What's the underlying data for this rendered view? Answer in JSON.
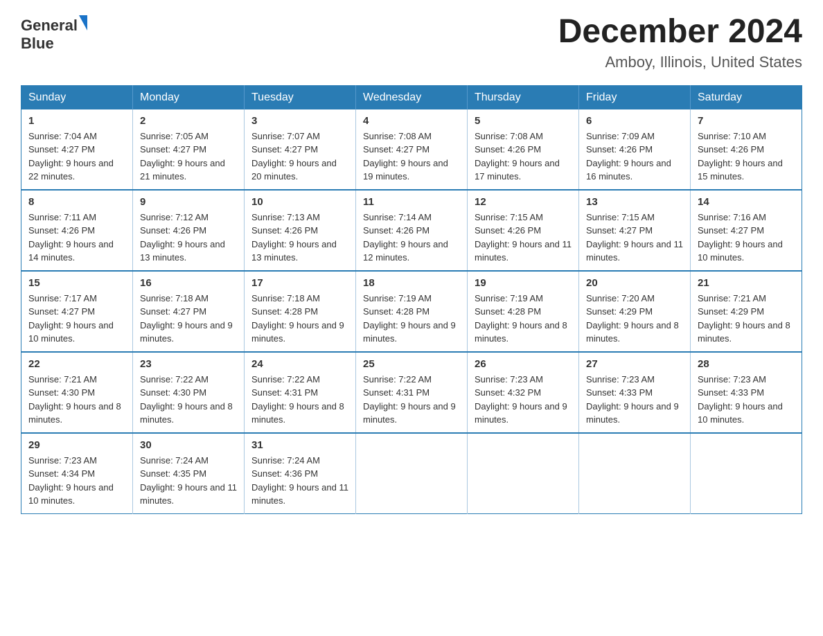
{
  "header": {
    "logo_text_general": "General",
    "logo_text_blue": "Blue",
    "month_year": "December 2024",
    "location": "Amboy, Illinois, United States"
  },
  "weekdays": [
    "Sunday",
    "Monday",
    "Tuesday",
    "Wednesday",
    "Thursday",
    "Friday",
    "Saturday"
  ],
  "weeks": [
    [
      {
        "day": "1",
        "sunrise": "7:04 AM",
        "sunset": "4:27 PM",
        "daylight": "9 hours and 22 minutes."
      },
      {
        "day": "2",
        "sunrise": "7:05 AM",
        "sunset": "4:27 PM",
        "daylight": "9 hours and 21 minutes."
      },
      {
        "day": "3",
        "sunrise": "7:07 AM",
        "sunset": "4:27 PM",
        "daylight": "9 hours and 20 minutes."
      },
      {
        "day": "4",
        "sunrise": "7:08 AM",
        "sunset": "4:27 PM",
        "daylight": "9 hours and 19 minutes."
      },
      {
        "day": "5",
        "sunrise": "7:08 AM",
        "sunset": "4:26 PM",
        "daylight": "9 hours and 17 minutes."
      },
      {
        "day": "6",
        "sunrise": "7:09 AM",
        "sunset": "4:26 PM",
        "daylight": "9 hours and 16 minutes."
      },
      {
        "day": "7",
        "sunrise": "7:10 AM",
        "sunset": "4:26 PM",
        "daylight": "9 hours and 15 minutes."
      }
    ],
    [
      {
        "day": "8",
        "sunrise": "7:11 AM",
        "sunset": "4:26 PM",
        "daylight": "9 hours and 14 minutes."
      },
      {
        "day": "9",
        "sunrise": "7:12 AM",
        "sunset": "4:26 PM",
        "daylight": "9 hours and 13 minutes."
      },
      {
        "day": "10",
        "sunrise": "7:13 AM",
        "sunset": "4:26 PM",
        "daylight": "9 hours and 13 minutes."
      },
      {
        "day": "11",
        "sunrise": "7:14 AM",
        "sunset": "4:26 PM",
        "daylight": "9 hours and 12 minutes."
      },
      {
        "day": "12",
        "sunrise": "7:15 AM",
        "sunset": "4:26 PM",
        "daylight": "9 hours and 11 minutes."
      },
      {
        "day": "13",
        "sunrise": "7:15 AM",
        "sunset": "4:27 PM",
        "daylight": "9 hours and 11 minutes."
      },
      {
        "day": "14",
        "sunrise": "7:16 AM",
        "sunset": "4:27 PM",
        "daylight": "9 hours and 10 minutes."
      }
    ],
    [
      {
        "day": "15",
        "sunrise": "7:17 AM",
        "sunset": "4:27 PM",
        "daylight": "9 hours and 10 minutes."
      },
      {
        "day": "16",
        "sunrise": "7:18 AM",
        "sunset": "4:27 PM",
        "daylight": "9 hours and 9 minutes."
      },
      {
        "day": "17",
        "sunrise": "7:18 AM",
        "sunset": "4:28 PM",
        "daylight": "9 hours and 9 minutes."
      },
      {
        "day": "18",
        "sunrise": "7:19 AM",
        "sunset": "4:28 PM",
        "daylight": "9 hours and 9 minutes."
      },
      {
        "day": "19",
        "sunrise": "7:19 AM",
        "sunset": "4:28 PM",
        "daylight": "9 hours and 8 minutes."
      },
      {
        "day": "20",
        "sunrise": "7:20 AM",
        "sunset": "4:29 PM",
        "daylight": "9 hours and 8 minutes."
      },
      {
        "day": "21",
        "sunrise": "7:21 AM",
        "sunset": "4:29 PM",
        "daylight": "9 hours and 8 minutes."
      }
    ],
    [
      {
        "day": "22",
        "sunrise": "7:21 AM",
        "sunset": "4:30 PM",
        "daylight": "9 hours and 8 minutes."
      },
      {
        "day": "23",
        "sunrise": "7:22 AM",
        "sunset": "4:30 PM",
        "daylight": "9 hours and 8 minutes."
      },
      {
        "day": "24",
        "sunrise": "7:22 AM",
        "sunset": "4:31 PM",
        "daylight": "9 hours and 8 minutes."
      },
      {
        "day": "25",
        "sunrise": "7:22 AM",
        "sunset": "4:31 PM",
        "daylight": "9 hours and 9 minutes."
      },
      {
        "day": "26",
        "sunrise": "7:23 AM",
        "sunset": "4:32 PM",
        "daylight": "9 hours and 9 minutes."
      },
      {
        "day": "27",
        "sunrise": "7:23 AM",
        "sunset": "4:33 PM",
        "daylight": "9 hours and 9 minutes."
      },
      {
        "day": "28",
        "sunrise": "7:23 AM",
        "sunset": "4:33 PM",
        "daylight": "9 hours and 10 minutes."
      }
    ],
    [
      {
        "day": "29",
        "sunrise": "7:23 AM",
        "sunset": "4:34 PM",
        "daylight": "9 hours and 10 minutes."
      },
      {
        "day": "30",
        "sunrise": "7:24 AM",
        "sunset": "4:35 PM",
        "daylight": "9 hours and 11 minutes."
      },
      {
        "day": "31",
        "sunrise": "7:24 AM",
        "sunset": "4:36 PM",
        "daylight": "9 hours and 11 minutes."
      },
      null,
      null,
      null,
      null
    ]
  ]
}
